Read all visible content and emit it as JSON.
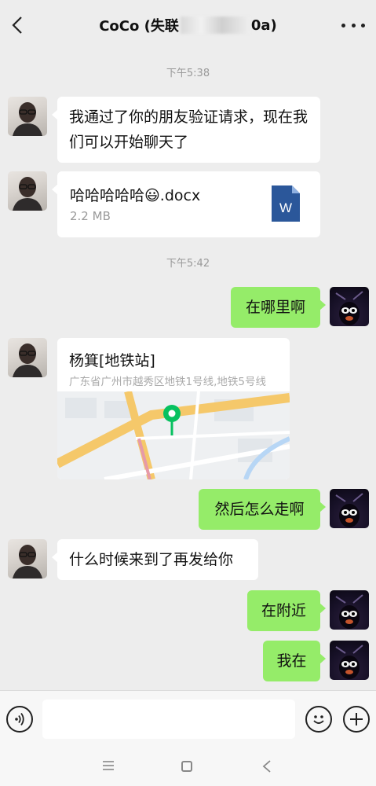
{
  "header": {
    "title_prefix": "CoCo (失联",
    "title_suffix": "0a)"
  },
  "messages": {
    "time1": "下午5:38",
    "m1": "我通过了你的朋友验证请求，现在我们可以开始聊天了",
    "file": {
      "name": "哈哈哈哈哈😃.docx",
      "size": "2.2 MB",
      "icon_letter": "W"
    },
    "time2": "下午5:42",
    "m2": "在哪里啊",
    "location": {
      "name": "杨箕[地铁站]",
      "address": "广东省广州市越秀区地铁1号线,地铁5号线"
    },
    "m3": "然后怎么走啊",
    "m4": "什么时候来到了再发给你",
    "m5": "在附近",
    "m6": "我在"
  },
  "input_bar": {
    "placeholder": ""
  },
  "colors": {
    "sent_bubble": "#95ec69",
    "received_bubble": "#ffffff",
    "background": "#ededed",
    "word_blue": "#2b579a",
    "map_pin": "#07c160"
  }
}
